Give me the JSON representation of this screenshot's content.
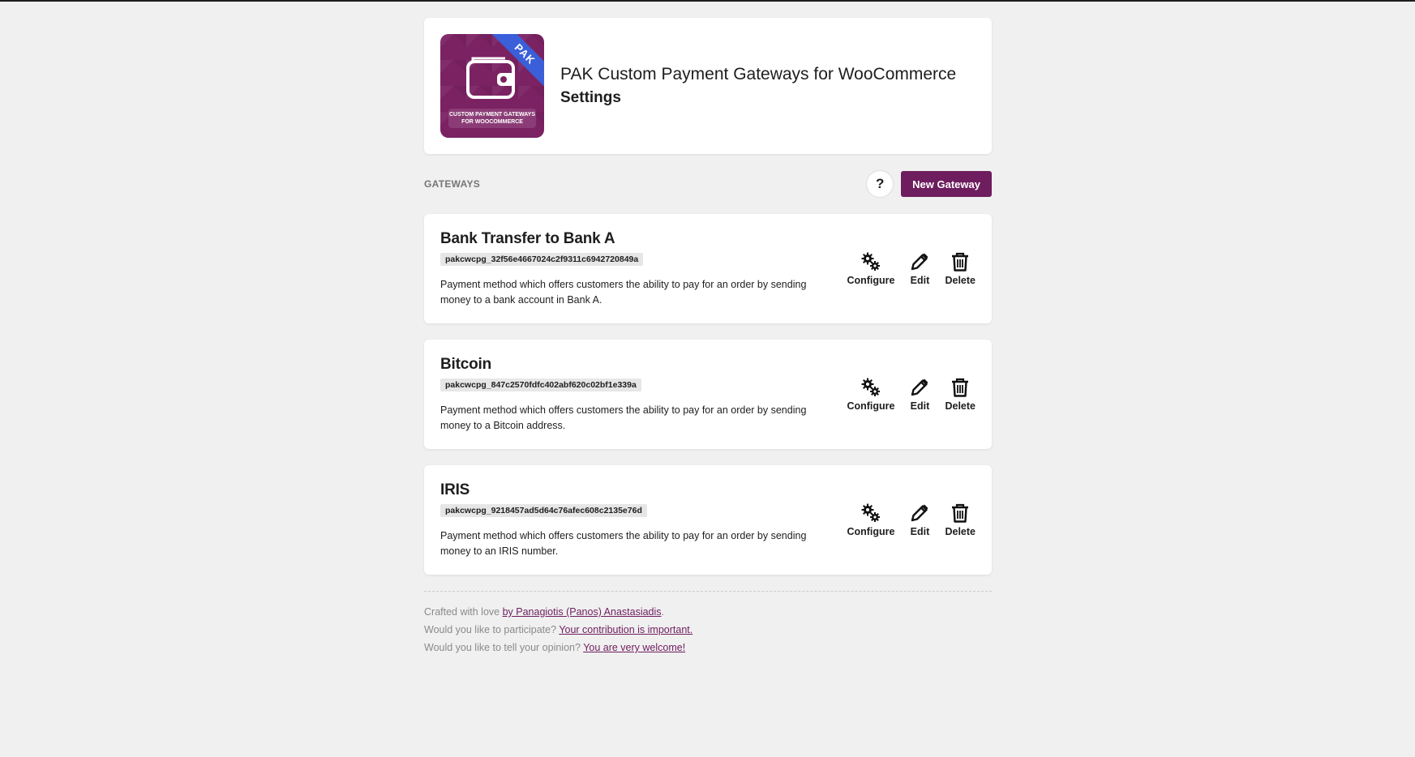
{
  "header": {
    "logo_badge": "PAK",
    "logo_caption": "CUSTOM PAYMENT GATEWAYS FOR WOOCOMMERCE",
    "title": "PAK Custom Payment Gateways for WooCommerce",
    "subtitle": "Settings"
  },
  "toolbar": {
    "section_label": "GATEWAYS",
    "help_label": "?",
    "new_gateway_label": "New Gateway"
  },
  "actions": {
    "configure": "Configure",
    "edit": "Edit",
    "delete": "Delete"
  },
  "gateways": [
    {
      "name": "Bank Transfer to Bank A",
      "id": "pakcwcpg_32f56e4667024c2f9311c6942720849a",
      "description": "Payment method which offers customers the ability to pay for an order by sending money to a bank account in Bank A."
    },
    {
      "name": "Bitcoin",
      "id": "pakcwcpg_847c2570fdfc402abf620c02bf1e339a",
      "description": "Payment method which offers customers the ability to pay for an order by sending money to a Bitcoin address."
    },
    {
      "name": "IRIS",
      "id": "pakcwcpg_9218457ad5d64c76afec608c2135e76d",
      "description": "Payment method which offers customers the ability to pay for an order by sending money to an IRIS number."
    }
  ],
  "footer": {
    "line1_text": "Crafted with love ",
    "line1_link": "by Panagiotis (Panos) Anastasiadis",
    "line1_end": ".",
    "line2_text": "Would you like to participate? ",
    "line2_link": "Your contribution is important.",
    "line3_text": "Would you like to tell your opinion? ",
    "line3_link": "You are very welcome!"
  },
  "colors": {
    "brand": "#6e1d5f",
    "ribbon": "#3a5fd9",
    "background": "#f0f0f0"
  }
}
